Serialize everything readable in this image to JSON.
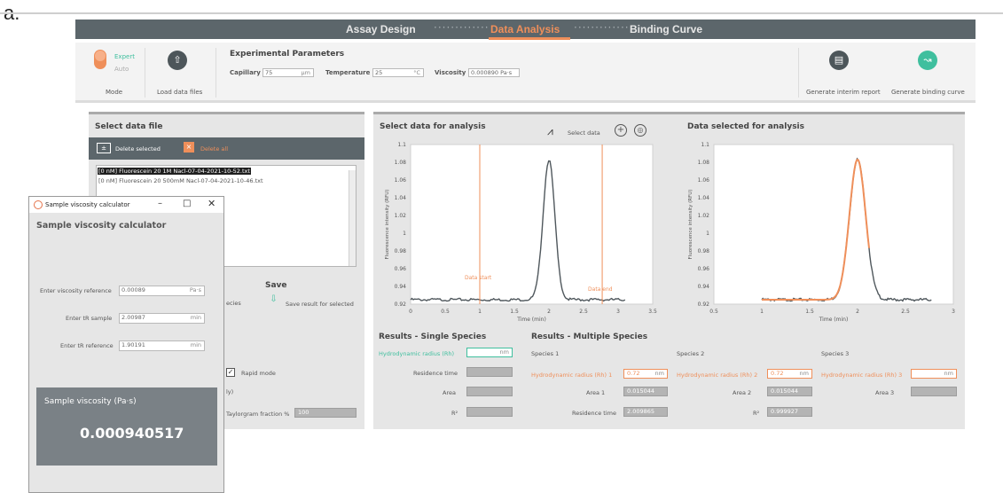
{
  "figure_label": "a.",
  "nav": {
    "items": [
      "Assay Design",
      "Data Analysis",
      "Binding Curve"
    ],
    "active": "Data Analysis",
    "separator": "·············"
  },
  "toolbar": {
    "mode": {
      "expert": "Expert",
      "auto": "Auto",
      "label": "Mode"
    },
    "load_label": "Load data files",
    "params_title": "Experimental Parameters",
    "capillary": {
      "label": "Capillary",
      "value": "75",
      "unit": "µm"
    },
    "temperature": {
      "label": "Temperature",
      "value": "25",
      "unit": "°C"
    },
    "viscosity": {
      "label": "Viscosity",
      "value": "0.000890 Pa·s"
    },
    "interim_label": "Generate interim report",
    "binding_label": "Generate binding curve"
  },
  "left_panel": {
    "title": "Select data file",
    "delete_selected": "Delete selected",
    "delete_all": "Delete all",
    "files": [
      "[0 nM] Fluorescein 20 1M Nacl-07-04-2021-10-52.txt",
      "[0 nM] Fluorescein 20 500mM Nacl-07-04-2021-10-46.txt"
    ],
    "save_title": "Save",
    "save_for_selected": "Save result for selected",
    "species_partial": "ecies",
    "rapid_mode": "Rapid mode",
    "paren_partial": "ly)",
    "taylorgram_label": "Taylorgram fraction %",
    "taylorgram_value": "100"
  },
  "chart_panel": {
    "select_title": "Select data for analysis",
    "select_data_label": "Select data",
    "selected_title": "Data selected for analysis"
  },
  "chart_data": [
    {
      "type": "line",
      "title": "Select data for analysis",
      "xlabel": "Time (min)",
      "ylabel": "Fluorescence intensity (RFU)",
      "xlim": [
        0,
        3.5
      ],
      "ylim": [
        0.92,
        1.1
      ],
      "xticks": [
        "0",
        "0.5",
        "1",
        "1.5",
        "2",
        "2.5",
        "3",
        "3.5"
      ],
      "yticks": [
        "0.92",
        "0.94",
        "0.96",
        "0.98",
        "1",
        "1.02",
        "1.04",
        "1.06",
        "1.08",
        "1.1"
      ],
      "peak": {
        "center": 2.0,
        "height": 1.083,
        "baseline": 0.925,
        "sigma": 0.085
      },
      "data_start": {
        "x": 1.0,
        "label": "Data start"
      },
      "data_end": {
        "x": 2.77,
        "label": "Data end"
      },
      "colors": {
        "trace": "#4f575c",
        "markers": "#ef8f5a"
      }
    },
    {
      "type": "line",
      "title": "Data selected for analysis",
      "xlabel": "Time (min)",
      "ylabel": "Fluorescence intensity (RFU)",
      "xlim": [
        0.5,
        3
      ],
      "ylim": [
        0.92,
        1.1
      ],
      "xticks": [
        "0.5",
        "1",
        "1.5",
        "2",
        "2.5",
        "3"
      ],
      "yticks": [
        "0.92",
        "0.94",
        "0.96",
        "0.98",
        "1",
        "1.02",
        "1.04",
        "1.06",
        "1.08",
        "1.1"
      ],
      "series": [
        {
          "kind": "data",
          "x_range": [
            1.0,
            2.77
          ],
          "center": 2.0,
          "height": 1.083,
          "baseline": 0.925,
          "sigma": 0.085
        },
        {
          "kind": "fit",
          "x_range": [
            1.0,
            2.12
          ],
          "center": 2.0,
          "height": 1.083,
          "baseline": 0.925,
          "sigma": 0.085
        }
      ],
      "colors": {
        "trace": "#4f575c",
        "fit": "#ef8f5a"
      }
    }
  ],
  "results": {
    "single_title": "Results - Single Species",
    "rh_label": "Hydrodynamic radius (Rh)",
    "rh_unit": "nm",
    "residence_label": "Residence time",
    "area_label": "Area",
    "r2_label": "R²",
    "multi_title": "Results - Multiple Species",
    "species1": {
      "title": "Species 1",
      "rh_label": "Hydrodynamic radius (Rh) 1",
      "rh_value": "0.72",
      "unit": "nm",
      "area_label": "Area 1",
      "area_value": "0.015044",
      "residence_label": "Residence time",
      "residence_value": "2.009865"
    },
    "species2": {
      "title": "Species 2",
      "rh_label": "Hydrodynamic radius (Rh) 2",
      "rh_value": "0.72",
      "unit": "nm",
      "area_label": "Area 2",
      "area_value": "0.015044",
      "r2_label": "R²",
      "r2_value": "0.999927"
    },
    "species3": {
      "title": "Species 3",
      "rh_label": "Hydrodynamic radius (Rh) 3",
      "unit": "nm",
      "area_label": "Area 3"
    }
  },
  "popup": {
    "window_title": "Sample viscosity calculator",
    "heading": "Sample viscosity calculator",
    "ref_label": "Enter viscosity reference",
    "ref_value": "0.00089",
    "ref_unit": "Pa·s",
    "tr_sample_label": "Enter tR sample",
    "tr_sample_value": "2.00987",
    "tr_sample_unit": "min",
    "tr_ref_label": "Enter tR reference",
    "tr_ref_value": "1.90191",
    "tr_ref_unit": "min",
    "result_label": "Sample viscosity (Pa·s)",
    "result_value": "0.000940517"
  }
}
